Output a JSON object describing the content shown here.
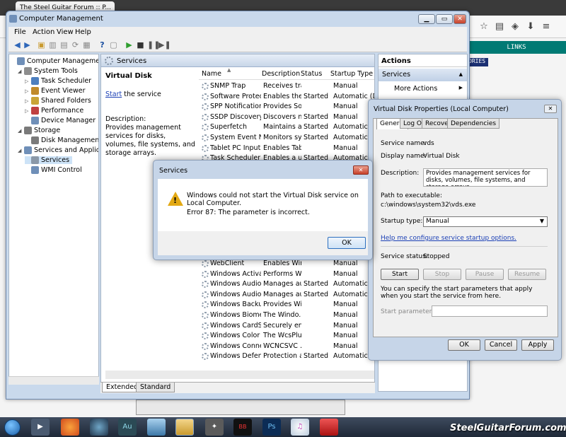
{
  "browser": {
    "tab_title": "The Steel Guitar Forum :: P...",
    "links_label": "LINKS",
    "partial_label": "ORIES"
  },
  "window": {
    "title": "Computer Management",
    "menu": [
      "File",
      "Action",
      "View",
      "Help"
    ]
  },
  "tree": {
    "items": [
      {
        "label": "Computer Management (Local",
        "level": 0
      },
      {
        "label": "System Tools",
        "level": 1
      },
      {
        "label": "Task Scheduler",
        "level": 2
      },
      {
        "label": "Event Viewer",
        "level": 2
      },
      {
        "label": "Shared Folders",
        "level": 2
      },
      {
        "label": "Performance",
        "level": 2
      },
      {
        "label": "Device Manager",
        "level": 2
      },
      {
        "label": "Storage",
        "level": 1
      },
      {
        "label": "Disk Management",
        "level": 2
      },
      {
        "label": "Services and Applications",
        "level": 1
      },
      {
        "label": "Services",
        "level": 2
      },
      {
        "label": "WMI Control",
        "level": 2
      }
    ]
  },
  "center": {
    "header": "Services",
    "selected_service": "Virtual Disk",
    "start_link": "Start",
    "start_suffix": " the service",
    "description_label": "Description:",
    "description": "Provides management services for disks, volumes, file systems, and storage arrays.",
    "columns": [
      "Name",
      "Description",
      "Status",
      "Startup Type"
    ],
    "rows_top": [
      [
        "SNMP Trap",
        "Receives tra...",
        "",
        "Manual"
      ],
      [
        "Software Protection",
        "Enables the ...",
        "Started",
        "Automatic (D..."
      ],
      [
        "SPP Notification S...",
        "Provides So...",
        "",
        "Manual"
      ],
      [
        "SSDP Discovery",
        "Discovers n...",
        "Started",
        "Manual"
      ],
      [
        "Superfetch",
        "Maintains a...",
        "Started",
        "Automatic"
      ],
      [
        "System Event Noti...",
        "Monitors sy...",
        "Started",
        "Automatic"
      ],
      [
        "Tablet PC Input Se...",
        "Enables Tab...",
        "",
        "Manual"
      ],
      [
        "Task Scheduler",
        "Enables a u...",
        "Started",
        "Automatic"
      ]
    ],
    "rows_bottom": [
      [
        "WebClient",
        "Enables Win...",
        "",
        "Manual"
      ],
      [
        "Windows Activati...",
        "Performs W...",
        "",
        "Manual"
      ],
      [
        "Windows Audio",
        "Manages au...",
        "Started",
        "Automatic"
      ],
      [
        "Windows Audio E...",
        "Manages au...",
        "Started",
        "Automatic"
      ],
      [
        "Windows Backup",
        "Provides Wi...",
        "",
        "Manual"
      ],
      [
        "Windows Biometri...",
        "The Windo...",
        "",
        "Manual"
      ],
      [
        "Windows CardSpa...",
        "Securely en...",
        "",
        "Manual"
      ],
      [
        "Windows Color Sy...",
        "The WcsPlu...",
        "",
        "Manual"
      ],
      [
        "Windows Connect...",
        "WCNCSVC ...",
        "",
        "Manual"
      ],
      [
        "Windows Defender",
        "Protection a...",
        "Started",
        "Automatic (D..."
      ]
    ],
    "tabs": [
      "Extended",
      "Standard"
    ]
  },
  "actions": {
    "header": "Actions",
    "section": "Services",
    "more": "More Actions"
  },
  "properties": {
    "title": "Virtual Disk Properties (Local Computer)",
    "tabs": [
      "General",
      "Log On",
      "Recovery",
      "Dependencies"
    ],
    "service_name_label": "Service name:",
    "service_name": "vds",
    "display_name_label": "Display name:",
    "display_name": "Virtual Disk",
    "description_label": "Description:",
    "description": "Provides management services for disks, volumes, file systems, and storage arrays.",
    "path_label": "Path to executable:",
    "path": "c:\\windows\\system32\\vds.exe",
    "startup_type_label": "Startup type:",
    "startup_type": "Manual",
    "help_link": "Help me configure service startup options.",
    "status_label": "Service status:",
    "status": "Stopped",
    "buttons": [
      "Start",
      "Stop",
      "Pause",
      "Resume"
    ],
    "params_note": "You can specify the start parameters that apply when you start the service from here.",
    "params_label": "Start parameters:",
    "ok": "OK",
    "cancel": "Cancel",
    "apply": "Apply"
  },
  "error_dialog": {
    "title": "Services",
    "message": "Windows could not start the Virtual Disk service on Local Computer.",
    "error": "Error 87: The parameter is incorrect.",
    "ok": "OK"
  },
  "taskbar": {
    "watermark": "SteelGuitarForum.com",
    "apps": [
      "Au",
      "BB",
      "Ps"
    ]
  }
}
